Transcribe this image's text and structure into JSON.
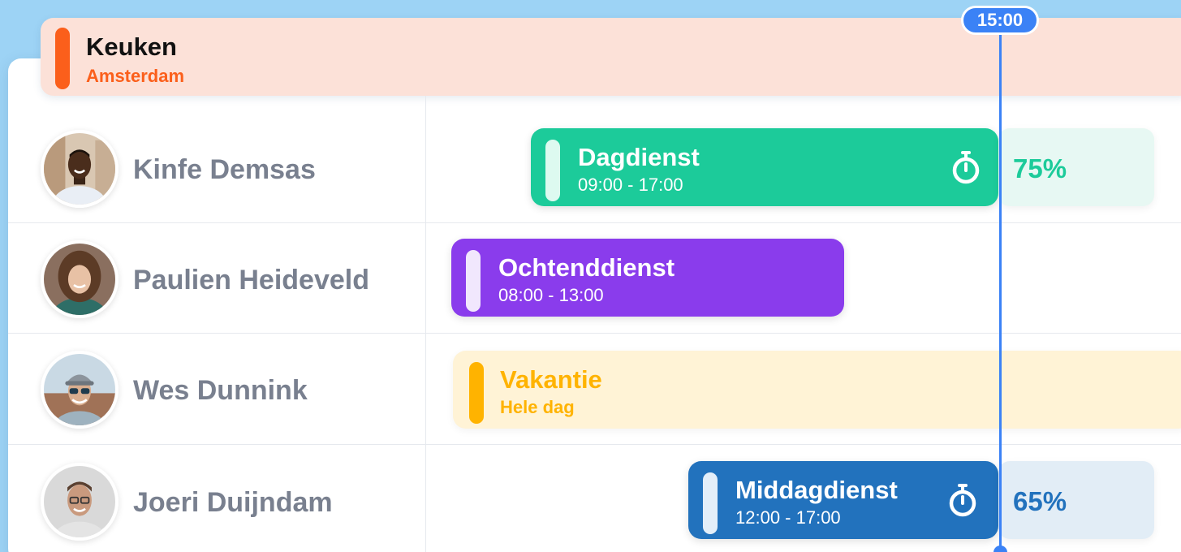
{
  "header": {
    "title": "Keuken",
    "location": "Amsterdam"
  },
  "current_time": "15:00",
  "colors": {
    "header_accent": "#fb5f1b",
    "dagdienst": "#1ccb9a",
    "ochtenddienst": "#8a3cec",
    "vakantie": "#ffb300",
    "middagdienst": "#2272bd",
    "now_line": "#3b82f6"
  },
  "employees": [
    {
      "name": "Kinfe Demsas",
      "shift": {
        "title": "Dagdienst",
        "time": "09:00 - 17:00",
        "icon": "stopwatch-icon",
        "progress": "75%"
      }
    },
    {
      "name": "Paulien Heideveld",
      "shift": {
        "title": "Ochtenddienst",
        "time": "08:00 - 13:00"
      }
    },
    {
      "name": "Wes Dunnink",
      "shift": {
        "title": "Vakantie",
        "time": "Hele dag"
      }
    },
    {
      "name": "Joeri Duijndam",
      "shift": {
        "title": "Middagdienst",
        "time": "12:00 - 17:00",
        "icon": "stopwatch-icon",
        "progress": "65%"
      }
    }
  ]
}
